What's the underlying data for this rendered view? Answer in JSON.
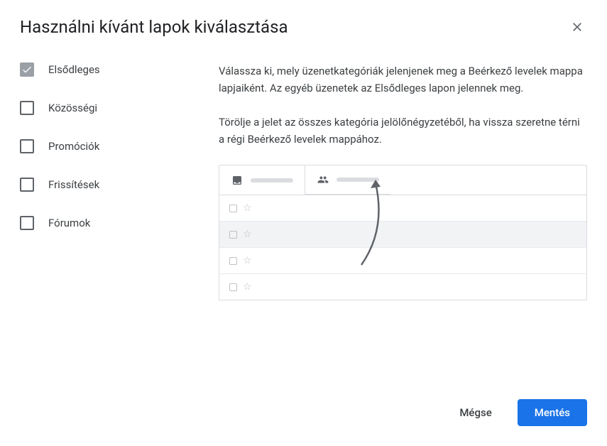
{
  "dialog": {
    "title": "Használni kívánt lapok kiválasztása"
  },
  "categories": [
    {
      "label": "Elsődleges",
      "checked": true
    },
    {
      "label": "Közösségi",
      "checked": false
    },
    {
      "label": "Promóciók",
      "checked": false
    },
    {
      "label": "Frissítések",
      "checked": false
    },
    {
      "label": "Fórumok",
      "checked": false
    }
  ],
  "description": {
    "p1": "Válassza ki, mely üzenetkategóriák jelenjenek meg a Beérkező levelek mappa lapjaiként. Az egyéb üzenetek az Elsődleges lapon jelennek meg.",
    "p2": "Törölje a jelet az összes kategória jelölőnégyzetéből, ha vissza szeretne térni a régi Beérkező levelek mappához."
  },
  "buttons": {
    "cancel": "Mégse",
    "save": "Mentés"
  }
}
